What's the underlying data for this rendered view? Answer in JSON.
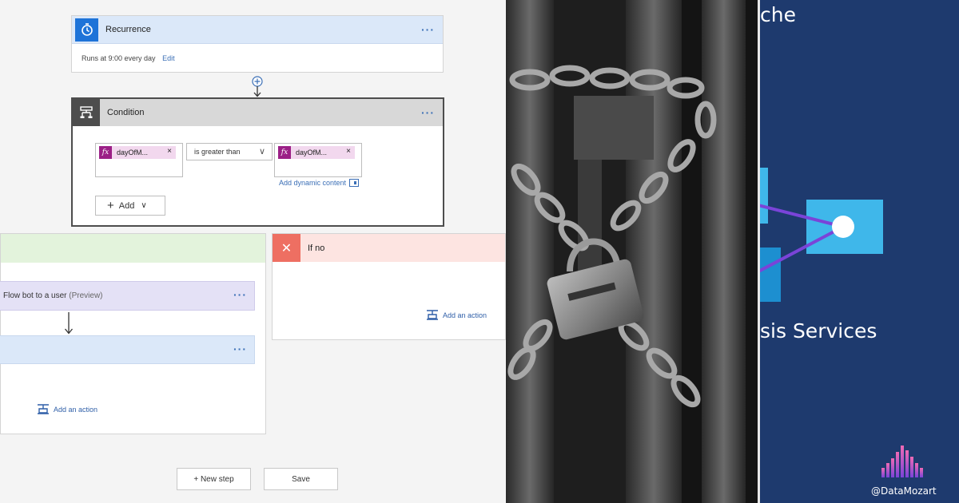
{
  "flow": {
    "recurrence": {
      "title": "Recurrence",
      "runs_text": "Runs at 9:00 every day",
      "edit_label": "Edit",
      "menu": "···"
    },
    "condition": {
      "title": "Condition",
      "menu": "···",
      "left_token": "dayOfM...",
      "operator": "is greater than",
      "right_token": "dayOfM...",
      "token_icon": "fx",
      "token_remove": "×",
      "dynamic_content_label": "Add dynamic content",
      "add_label": "Add",
      "add_chevron": "∨"
    },
    "if_yes": {
      "flowbot_title": "Flow bot to a user",
      "flowbot_tag": "(Preview)",
      "menu": "···",
      "add_action": "Add an action"
    },
    "if_no": {
      "title": "If no",
      "close_glyph": "✕",
      "add_action": "Add an action"
    },
    "new_step_label": "+ New step",
    "save_label": "Save"
  },
  "right_panel": {
    "title_fragment_top": "che",
    "title_fragment_bottom": "sis Services",
    "handle": "@DataMozart"
  },
  "colors": {
    "recurrence_accent": "#1e73d8",
    "condition_accent": "#4d4d4d",
    "if_yes_header": "#e3f3dc",
    "if_no_header": "#fde4e1",
    "if_no_accent": "#ee6f62",
    "link_blue": "#3b6fb6",
    "token_magenta": "#9b1f86",
    "right_panel_bg": "#1e3a6e",
    "cube_light": "#3fb7ea",
    "cube_dark": "#1d8fd0",
    "connector_purple": "#7a44d8"
  },
  "icons": {
    "recurrence": "alarm-clock-icon",
    "condition": "condition-icon",
    "if_no": "close-icon",
    "add_action": "add-action-icon",
    "dynamic_content": "dynamic-content-icon",
    "logo": "datamozart-logo-icon"
  }
}
